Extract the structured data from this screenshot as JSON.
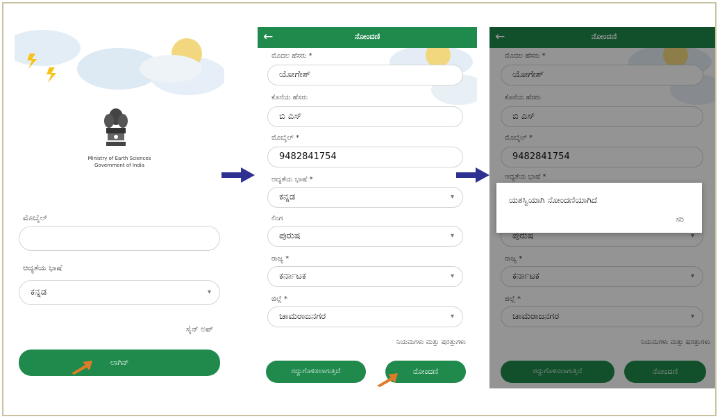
{
  "screen1": {
    "emblem_text": "Ministry of Earth Sciences",
    "emblem_subtext": "Government of India",
    "mobile_label": "ಮೊಬೈಲ್",
    "mobile_value": "",
    "language_label": "ಆದ್ಯತೆಯ ಭಾಷೆ",
    "language_value": "ಕನ್ನಡ",
    "signup_link": "ಸೈನ್ ಅಪ್",
    "login_button": "ಲಾಗಿನ್"
  },
  "screen2": {
    "title": "ನೋಂದಣಿ",
    "name_label": "ಮೊದಲ ಹೆಸರು *",
    "name_value": "ಯೋಗೇಶ್",
    "last_label": "ಕೊನೆಯ ಹೆಸರು",
    "last_value": "ಬಿ ಎಸ್",
    "mobile_label": "ಮೊಬೈಲ್ *",
    "mobile_value": "9482841754",
    "language_label": "ಆದ್ಯತೆಯ ಭಾಷೆ *",
    "language_value": "ಕನ್ನಡ",
    "gender_label": "ಲಿಂಗ",
    "gender_value": "ಪುರುಷ",
    "state_label": "ರಾಜ್ಯ *",
    "state_value": "ಕರ್ನಾಟಕ",
    "district_label": "ಜಿಲ್ಲೆ *",
    "district_value": "ಚಾಮರಾಜನಗರ",
    "terms_link": "ನಿಯಮಗಳು ಮತ್ತು ಷರತ್ತುಗಳು",
    "cancel_button": "ರದ್ದುಗೊಳಿಸಲಾಗುತ್ತಿದೆ",
    "register_button": "ನೋಂದಣಿ"
  },
  "screen3": {
    "title": "ನೋಂದಣಿ",
    "name_label": "ಮೊದಲ ಹೆಸರು *",
    "name_value": "ಯೋಗೇಶ್",
    "last_label": "ಕೊನೆಯ ಹೆಸರು",
    "last_value": "ಬಿ ಎಸ್",
    "mobile_label": "ಮೊಬೈಲ್ *",
    "mobile_value": "9482841754",
    "language_label": "ಆದ್ಯತೆಯ ಭಾಷೆ *",
    "gender_value": "ಪುರುಷ",
    "state_label": "ರಾಜ್ಯ *",
    "state_value": "ಕರ್ನಾಟಕ",
    "district_label": "ಜಿಲ್ಲೆ *",
    "district_value": "ಚಾಮರಾಜನಗರ",
    "terms_link": "ನಿಯಮಗಳು ಮತ್ತು ಷರತ್ತುಗಳು",
    "cancel_button": "ರದ್ದುಗೊಳಿಸಲಾಗುತ್ತಿದೆ",
    "register_button": "ನೋಂದಣಿ",
    "dialog_message": "ಯಶಸ್ವಿಯಾಗಿ ನೋಂದಣಿಯಾಗಿದೆ",
    "dialog_ok": "ಸರಿ"
  },
  "colors": {
    "primary": "#1f8a4c",
    "arrow": "#2e3092",
    "pointer": "#e07b2a"
  }
}
